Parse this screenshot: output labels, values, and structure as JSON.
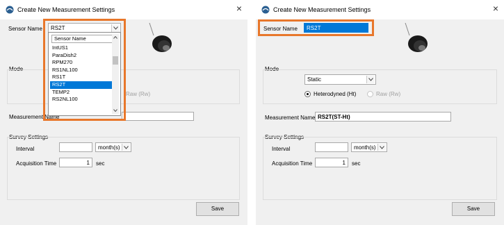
{
  "dialog": {
    "title": "Create New Measurement Settings",
    "close_glyph": "×",
    "app_icon": "app-logo-icon",
    "sensor_image": "sensor-probe-image"
  },
  "labels": {
    "sensor_name": "Sensor Name",
    "mode": "Mode",
    "measurement_name": "Measurement Name",
    "survey_settings": "Survey Settings",
    "interval": "Interval",
    "acquisition_time": "Acquisition Time",
    "sec": "sec",
    "save": "Save"
  },
  "left": {
    "sensor_value": "RS2T",
    "dropdown_header": "Sensor Name",
    "dropdown_items": [
      "IntUS1",
      "ParaDish2",
      "RPM270",
      "RS1NL100",
      "RS1T",
      "RS2T",
      "TEMP2",
      "RS2NL100"
    ],
    "dropdown_selected": "RS2T",
    "raw_partial": "Raw (Rw)",
    "measurement_name_partial": "N",
    "interval_value": "",
    "interval_unit": "month(s)",
    "acquisition_value": "1"
  },
  "right": {
    "sensor_value": "RS2T",
    "mode_value": "Static",
    "radio_heterodyned": "Heterodyned (Ht)",
    "radio_raw": "Raw (Rw)",
    "measurement_name_value": "RS2T(ST-Ht)",
    "interval_value": "",
    "interval_unit": "month(s)",
    "acquisition_value": "1"
  },
  "colors": {
    "highlight": "#e8772b",
    "selection": "#0078d7"
  }
}
